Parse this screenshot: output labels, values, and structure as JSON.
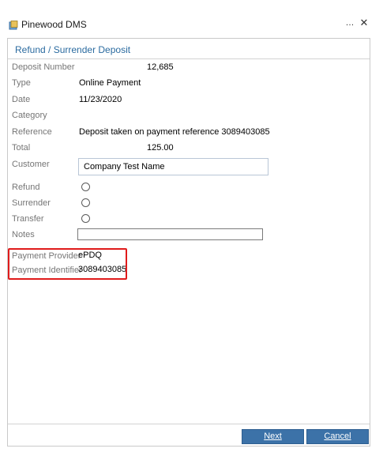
{
  "window": {
    "title": "Pinewood DMS",
    "minimize_label": "…",
    "close_label": "✕"
  },
  "panel": {
    "title": "Refund / Surrender Deposit"
  },
  "fields": {
    "deposit_number": {
      "label": "Deposit Number",
      "value": "12,685"
    },
    "type": {
      "label": "Type",
      "value": "Online Payment"
    },
    "date": {
      "label": "Date",
      "value": "11/23/2020"
    },
    "category": {
      "label": "Category",
      "value": ""
    },
    "reference": {
      "label": "Reference",
      "value": "Deposit taken on payment reference 3089403085"
    },
    "total": {
      "label": "Total",
      "value": "125.00"
    },
    "customer": {
      "label": "Customer",
      "value": "Company Test Name"
    },
    "refund": {
      "label": "Refund"
    },
    "surrender": {
      "label": "Surrender"
    },
    "transfer": {
      "label": "Transfer"
    },
    "notes": {
      "label": "Notes",
      "value": ""
    },
    "payment_provider": {
      "label": "Payment Provider",
      "value": "ePDQ"
    },
    "payment_identifier": {
      "label": "Payment Identifier",
      "value": "3089403085"
    }
  },
  "buttons": {
    "next": "Next",
    "cancel": "Cancel"
  },
  "colors": {
    "accent": "#2b6ba0",
    "button": "#3c72a8",
    "highlight": "#e01b1b"
  }
}
